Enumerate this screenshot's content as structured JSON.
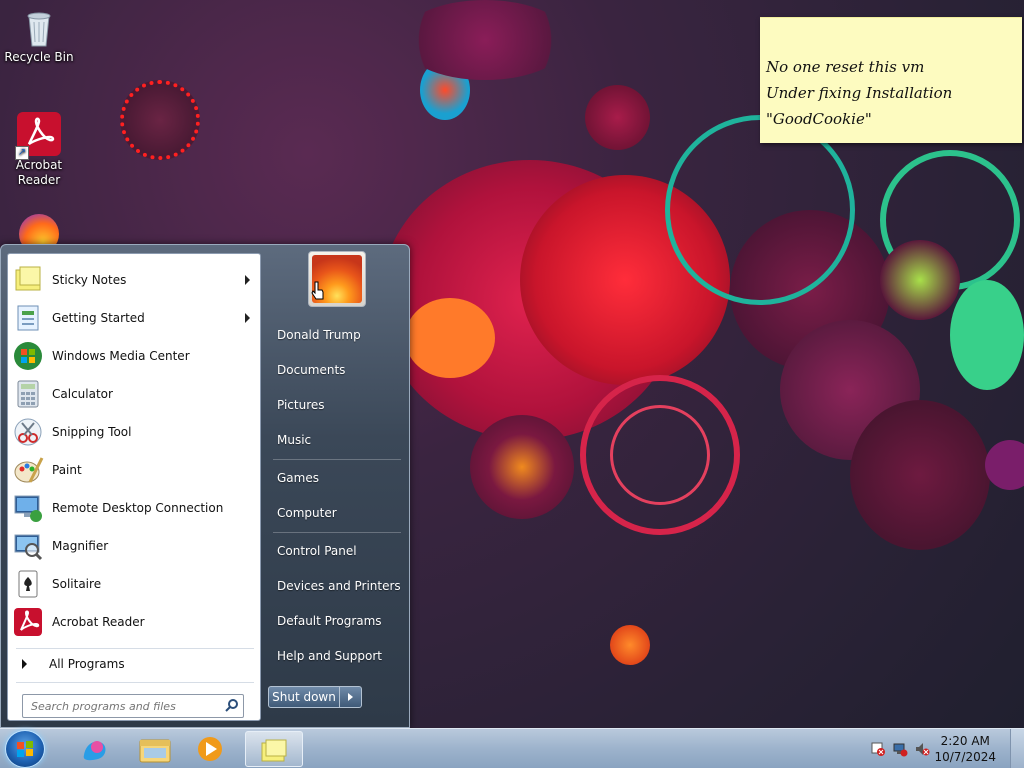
{
  "desktop": {
    "icons": [
      {
        "label_line1": "Recycle Bin",
        "label_line2": "",
        "icon": "recycle-bin-icon"
      },
      {
        "label_line1": "Acrobat",
        "label_line2": "Reader",
        "icon": "acrobat-reader-icon"
      }
    ],
    "sticky_note": {
      "lines": [
        "No one reset this vm",
        "Under fixing Installation",
        "\"GoodCookie\""
      ],
      "color": "#fdfbc0"
    }
  },
  "start_menu": {
    "programs": [
      {
        "label": "Sticky Notes",
        "icon": "sticky-notes-icon",
        "has_submenu": true
      },
      {
        "label": "Getting Started",
        "icon": "getting-started-icon",
        "has_submenu": true
      },
      {
        "label": "Windows Media Center",
        "icon": "media-center-icon",
        "has_submenu": false
      },
      {
        "label": "Calculator",
        "icon": "calculator-icon",
        "has_submenu": false
      },
      {
        "label": "Snipping Tool",
        "icon": "snipping-tool-icon",
        "has_submenu": false
      },
      {
        "label": "Paint",
        "icon": "paint-icon",
        "has_submenu": false
      },
      {
        "label": "Remote Desktop Connection",
        "icon": "remote-desktop-icon",
        "has_submenu": false
      },
      {
        "label": "Magnifier",
        "icon": "magnifier-icon",
        "has_submenu": false
      },
      {
        "label": "Solitaire",
        "icon": "solitaire-icon",
        "has_submenu": false
      },
      {
        "label": "Acrobat Reader",
        "icon": "acrobat-reader-icon",
        "has_submenu": false
      }
    ],
    "all_programs": "All Programs",
    "search_placeholder": "Search programs and files",
    "user_name": "Donald Trump",
    "right_items": [
      "Documents",
      "Pictures",
      "Music",
      "Games",
      "Computer",
      "Control Panel",
      "Devices and Printers",
      "Default Programs",
      "Help and Support"
    ],
    "shutdown_label": "Shut down"
  },
  "taskbar": {
    "pinned": [
      "start-orb-icon",
      "windows-live-icon",
      "explorer-icon",
      "media-player-icon",
      "sticky-notes-icon"
    ],
    "tray_icons": [
      "action-center-alert-icon",
      "network-alert-icon",
      "volume-muted-icon"
    ],
    "time": "2:20 AM",
    "date": "10/7/2024"
  },
  "colors": {
    "start_menu_bg": "#3b4858",
    "taskbar": "#9db3cc",
    "accent_red": "#c8102e"
  }
}
